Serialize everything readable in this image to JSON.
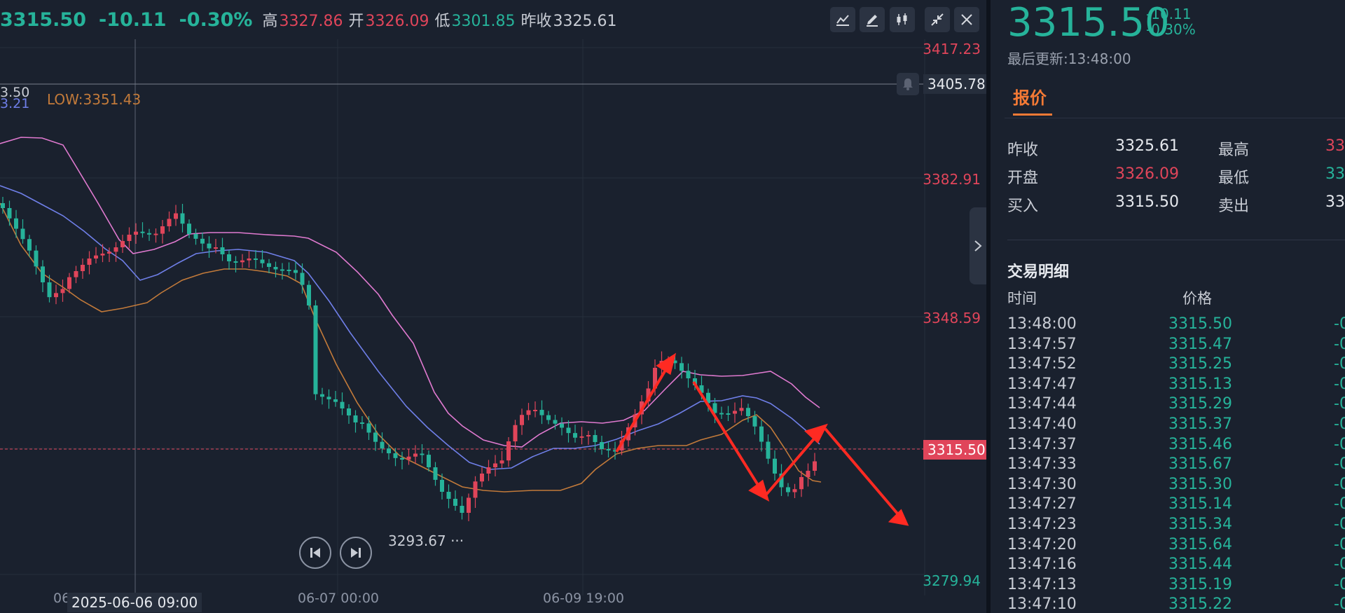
{
  "header": {
    "price": "3315.50",
    "change": "-10.11",
    "change_pct": "-0.30%",
    "high_label": "高",
    "high": "3327.86",
    "open_label": "开",
    "open": "3326.09",
    "low_label": "低",
    "low": "3301.85",
    "prev_close_label": "昨收",
    "prev_close": "3325.61"
  },
  "toolbar": {
    "icons": [
      "line-tool-icon",
      "pencil-icon",
      "candlestick-icon",
      "collapse-arrows-icon",
      "close-icon"
    ]
  },
  "legend": {
    "left_fragment_top": "3.50",
    "left_fragment_bottom": "3.21",
    "low_text": "LOW:3351.43"
  },
  "price_axis": [
    "3417.23",
    "3382.91",
    "3348.59",
    "3279.94"
  ],
  "alert_line": {
    "value": "3405.78",
    "icon": "bell-icon"
  },
  "current_price_tag": "3315.50",
  "min_marker": "3293.67",
  "x_axis": {
    "crosshair_date": "2025-06-06 09:00",
    "crosshair_partial": "06",
    "labels": [
      "06-07 00:00",
      "06-09 19:00"
    ]
  },
  "colors": {
    "up": "#e0455a",
    "down": "#26b39a",
    "ma_pink": "#e07ad0",
    "ma_blue": "#6f7fe8",
    "ma_orange": "#c27a3a",
    "arrow": "#ff2a22",
    "tab_accent": "#f57a35"
  },
  "side": {
    "price": "3315.50",
    "change": "-10.11",
    "change_pct": "-0.30%",
    "last_update": "最后更新:13:48:00",
    "tab": "报价",
    "quote": {
      "prev_close_label": "昨收",
      "prev_close": "3325.61",
      "high_label": "最高",
      "high": "33",
      "open_label": "开盘",
      "open": "3326.09",
      "low_label": "最低",
      "low": "33",
      "bid_label": "买入",
      "bid": "3315.50",
      "ask_label": "卖出",
      "ask": "33"
    },
    "trades_title": "交易明细",
    "trades_head_time": "时间",
    "trades_head_price": "价格",
    "trades": [
      {
        "time": "13:48:00",
        "price": "3315.50",
        "chg": "-0"
      },
      {
        "time": "13:47:57",
        "price": "3315.47",
        "chg": "-0"
      },
      {
        "time": "13:47:52",
        "price": "3315.25",
        "chg": "-0"
      },
      {
        "time": "13:47:47",
        "price": "3315.13",
        "chg": "-0"
      },
      {
        "time": "13:47:44",
        "price": "3315.29",
        "chg": "-0"
      },
      {
        "time": "13:47:40",
        "price": "3315.37",
        "chg": "-0"
      },
      {
        "time": "13:47:37",
        "price": "3315.46",
        "chg": "-0"
      },
      {
        "time": "13:47:33",
        "price": "3315.67",
        "chg": "-0"
      },
      {
        "time": "13:47:30",
        "price": "3315.30",
        "chg": "-0"
      },
      {
        "time": "13:47:27",
        "price": "3315.14",
        "chg": "-0"
      },
      {
        "time": "13:47:23",
        "price": "3315.34",
        "chg": "-0"
      },
      {
        "time": "13:47:20",
        "price": "3315.64",
        "chg": "-0"
      },
      {
        "time": "13:47:16",
        "price": "3315.44",
        "chg": "-0"
      },
      {
        "time": "13:47:13",
        "price": "3315.19",
        "chg": "-0"
      },
      {
        "time": "13:47:10",
        "price": "3315.22",
        "chg": "-0"
      }
    ]
  }
}
